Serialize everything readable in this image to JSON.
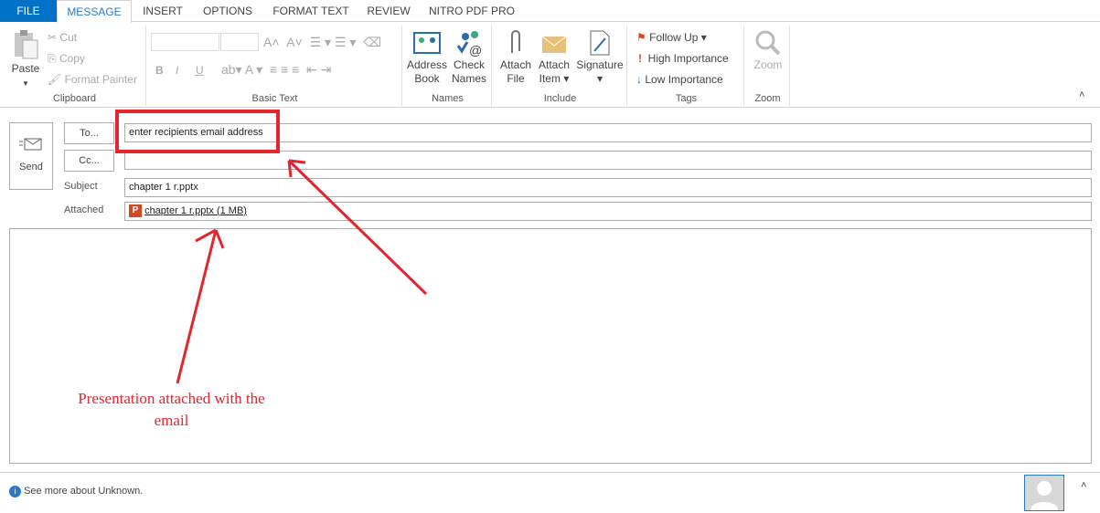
{
  "tabs": [
    "FILE",
    "MESSAGE",
    "INSERT",
    "OPTIONS",
    "FORMAT TEXT",
    "REVIEW",
    "NITRO PDF PRO"
  ],
  "clipboard": {
    "paste": "Paste",
    "cut": "Cut",
    "copy": "Copy",
    "format_painter": "Format Painter",
    "label": "Clipboard"
  },
  "basic_text": {
    "bold": "B",
    "italic": "I",
    "underline": "U",
    "label": "Basic Text"
  },
  "names": {
    "address_book": [
      "Address",
      "Book"
    ],
    "check_names": [
      "Check",
      "Names"
    ],
    "label": "Names"
  },
  "include": {
    "attach_file": [
      "Attach",
      "File"
    ],
    "attach_item": [
      "Attach",
      "Item"
    ],
    "signature": "Signature",
    "label": "Include"
  },
  "tags": {
    "follow_up": "Follow Up",
    "high": "High Importance",
    "low": "Low Importance",
    "label": "Tags"
  },
  "zoom": {
    "button": "Zoom",
    "label": "Zoom"
  },
  "compose": {
    "send": "Send",
    "to": "To...",
    "cc": "Cc...",
    "to_value": "enter recipients email address",
    "cc_value": "",
    "subject_label": "Subject",
    "subject_value": "chapter 1 r.pptx",
    "attached_label": "Attached",
    "attachment": "chapter 1 r.pptx (1 MB)",
    "attachment_icon": "P"
  },
  "annotation": [
    "Presentation attached with the",
    "email"
  ],
  "status": {
    "text": "See more about Unknown."
  },
  "colors": {
    "accent": "#0072c6",
    "annotation": "#e3262d"
  }
}
